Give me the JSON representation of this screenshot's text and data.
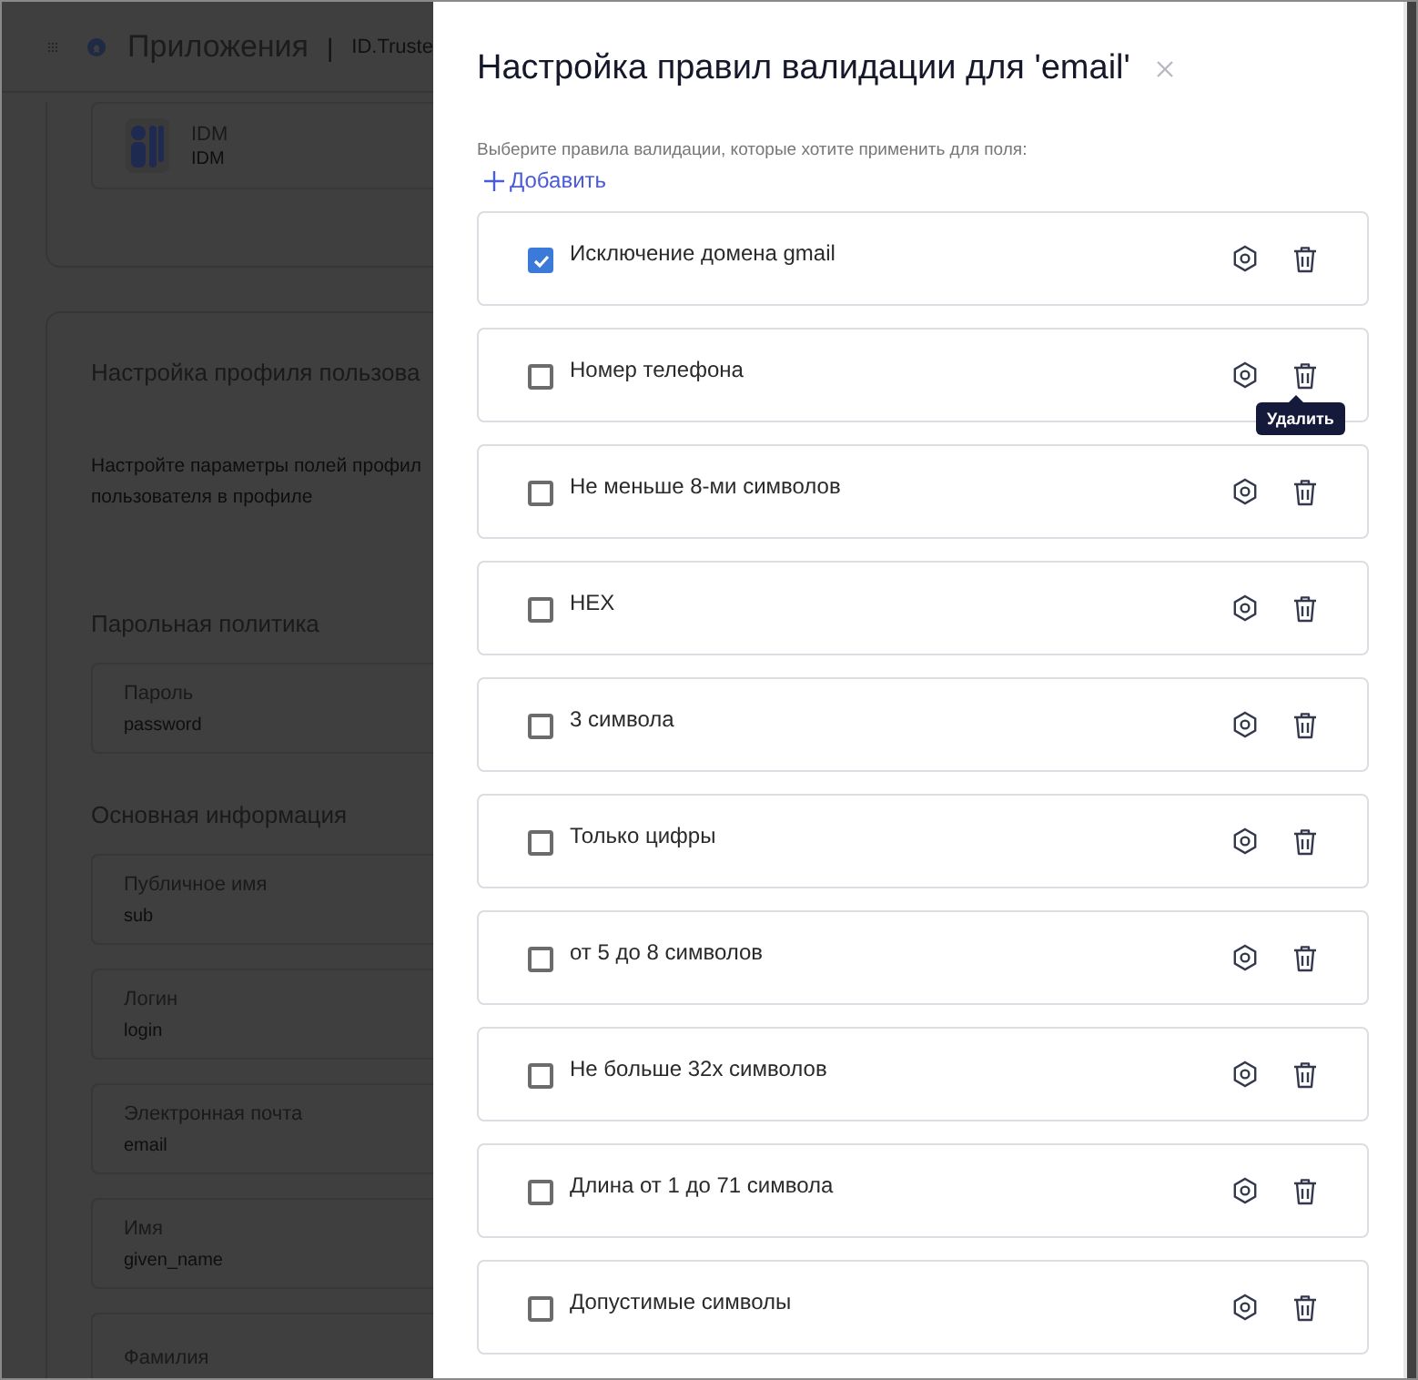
{
  "app_header": {
    "title": "Приложения",
    "separator": "|",
    "org": "ID.Truste"
  },
  "app_card": {
    "name": "IDM",
    "subtitle": "IDM"
  },
  "profile_section": {
    "title": "Настройка профиля пользова",
    "description_lines": [
      "Настройте параметры полей профил",
      "пользователя в профиле"
    ],
    "groups": [
      {
        "title": "Парольная политика",
        "fields": [
          {
            "label": "Пароль",
            "key": "password"
          }
        ]
      },
      {
        "title": "Основная информация",
        "fields": [
          {
            "label": "Публичное имя",
            "key": "sub"
          },
          {
            "label": "Логин",
            "key": "login"
          },
          {
            "label": "Электронная почта",
            "key": "email"
          },
          {
            "label": "Имя",
            "key": "given_name"
          },
          {
            "label": "Фамилия"
          }
        ]
      }
    ]
  },
  "drawer": {
    "title": "Настройка правил валидации для 'email'",
    "hint": "Выберите правила валидации, которые хотите применить для поля:",
    "add_label": "Добавить",
    "rules": [
      {
        "label": "Исключение домена gmail",
        "checked": true
      },
      {
        "label": "Номер телефона",
        "checked": false,
        "delete_tooltip": "Удалить"
      },
      {
        "label": "Не меньше 8-ми символов",
        "checked": false
      },
      {
        "label": "HEX",
        "checked": false
      },
      {
        "label": "3 символа",
        "checked": false
      },
      {
        "label": "Только цифры",
        "checked": false
      },
      {
        "label": "от 5 до 8 символов",
        "checked": false
      },
      {
        "label": "Не больше 32х символов",
        "checked": false
      },
      {
        "label": "Длина от 1 до 71 символа",
        "checked": false
      },
      {
        "label": "Допустимые символы",
        "checked": false
      }
    ]
  }
}
